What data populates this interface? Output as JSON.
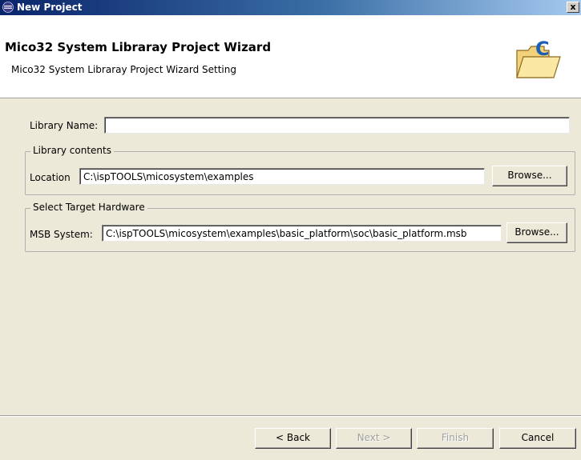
{
  "window": {
    "title": "New Project",
    "close_label": "x"
  },
  "banner": {
    "title": "Mico32 System Libraray Project Wizard",
    "subtitle": "Mico32 System Libraray Project Wizard Setting",
    "icon": "folder-c-icon"
  },
  "library_name": {
    "label": "Library Name:",
    "value": ""
  },
  "library_contents": {
    "legend": "Library contents",
    "location_label": "Location",
    "location_value": "C:\\ispTOOLS\\micosystem\\examples",
    "browse_label": "Browse..."
  },
  "target_hardware": {
    "legend": "Select Target Hardware",
    "msb_label": "MSB System:",
    "msb_value": "C:\\ispTOOLS\\micosystem\\examples\\basic_platform\\soc\\basic_platform.msb",
    "browse_label": "Browse..."
  },
  "buttons": {
    "back": "< Back",
    "next": "Next >",
    "finish": "Finish",
    "cancel": "Cancel"
  },
  "colors": {
    "titlebar": "#0a246a",
    "dialog_bg": "#ece9d8"
  }
}
